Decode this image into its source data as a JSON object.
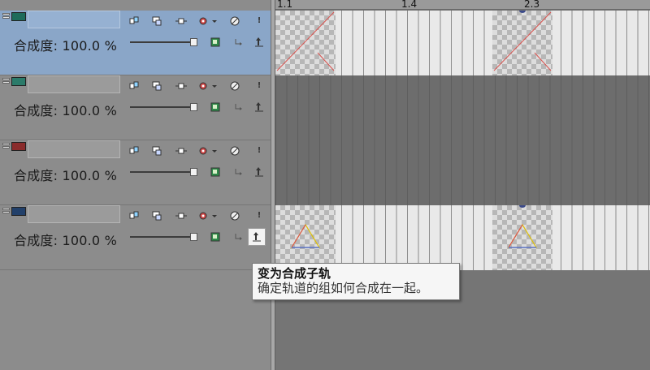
{
  "ruler": {
    "labels": [
      "1.1",
      "1.4",
      "2.3"
    ]
  },
  "tracks": [
    {
      "name": "",
      "compositing_label": "合成度: 100.0 %",
      "selected": true,
      "icon": "track-video-icon",
      "thumbnails": true
    },
    {
      "name": "",
      "compositing_label": "合成度: 100.0 %",
      "selected": false,
      "icon": "track-video-icon",
      "thumbnails": false
    },
    {
      "name": "",
      "compositing_label": "合成度: 100.0 %",
      "selected": false,
      "icon": "track-undo-icon",
      "thumbnails": false
    },
    {
      "name": "",
      "compositing_label": "合成度: 100.0 %",
      "selected": false,
      "icon": "track-video-icon",
      "thumbnails": true
    }
  ],
  "header_buttons": [
    "mute-icon",
    "bypass-fx-icon",
    "motion-icon",
    "gear-icon",
    "solo-icon",
    "info-icon"
  ],
  "tooltip": {
    "title": "变为合成子轨",
    "description": "确定轨道的组如何合成在一起。"
  },
  "colors": {
    "selected_track": "#8aa6c8",
    "panel": "#8c8c8c",
    "timeline": "#6f6f6f"
  }
}
